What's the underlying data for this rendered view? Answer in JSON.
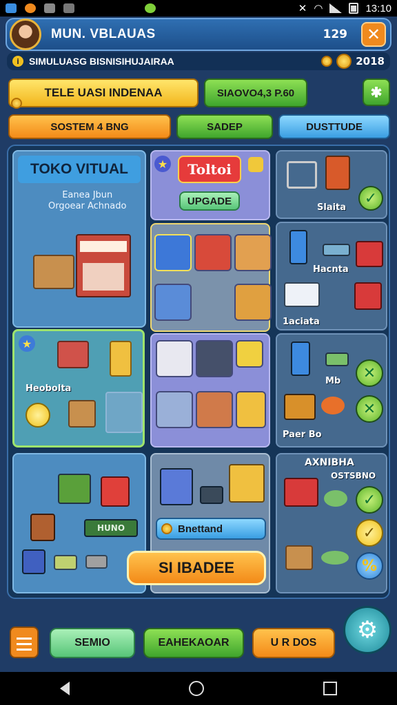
{
  "status": {
    "time": "13:10"
  },
  "header": {
    "title": "MUN. VBLAUAS",
    "number": "129",
    "close_glyph": "✕"
  },
  "ticker": {
    "text": "SIMULUASG BISNISIHUJAIRAA",
    "coins": "2018"
  },
  "top_buttons": {
    "primary": "TELE UASI INDENAA",
    "secondary": "SIAOVO4,3 P.60",
    "tab1": "SOSTEM 4 BNG",
    "tab2": "SADEP",
    "tab3": "DUSTTUDE"
  },
  "store": {
    "title": "TOKO VITUAL",
    "subtitle_line1": "Eanea Jbun",
    "subtitle_line2": "Orgoear Achnado"
  },
  "feature": {
    "banner": "Toltoi",
    "upgrade": "UPGADE"
  },
  "right_col": {
    "label1": "Slaita",
    "label2": "Hacnta",
    "label3": "1aciata",
    "label4": "Mb",
    "label5": "Paer Bo",
    "label6": "AXNIBHA",
    "label7": "OSTSBNO"
  },
  "left_mid": {
    "label": "Heobolta"
  },
  "bottom_panel": {
    "sign": "HUNO",
    "pill": "Bnettand",
    "big_button": "SI IBADEE"
  },
  "bottom_bar": {
    "b1": "SEMIO",
    "b2": "EAHEKAOAR",
    "b3": "U R DOS"
  }
}
